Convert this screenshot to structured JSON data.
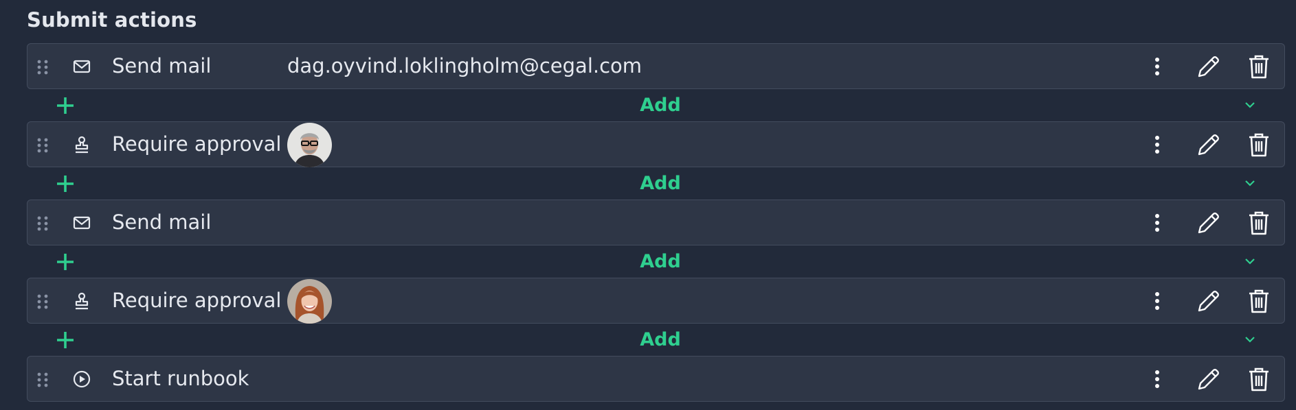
{
  "section": {
    "title": "Submit actions"
  },
  "colors": {
    "accent": "#2fcf8f",
    "background": "#222a3a",
    "row_bg": "#2e3646",
    "row_border": "#434c5e"
  },
  "actions": [
    {
      "label": "Send mail",
      "icon": "mail-icon",
      "detail": "dag.oyvind.loklingholm@cegal.com"
    },
    {
      "label": "Require approval",
      "icon": "stamp-icon",
      "avatar": "male-approver-avatar"
    },
    {
      "label": "Send mail",
      "icon": "mail-icon"
    },
    {
      "label": "Require approval",
      "icon": "stamp-icon",
      "avatar": "female-approver-avatar"
    },
    {
      "label": "Start runbook",
      "icon": "play-circle-icon"
    }
  ],
  "add": {
    "label": "Add"
  }
}
